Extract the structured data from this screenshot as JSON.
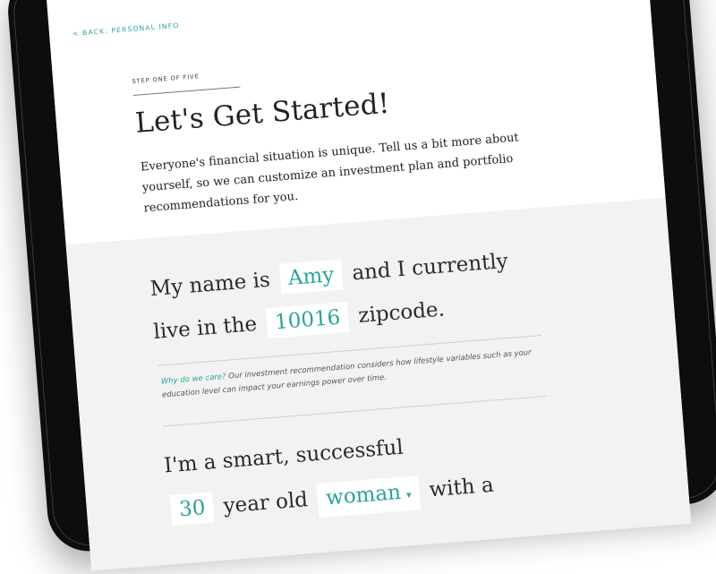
{
  "nav": {
    "back_label": "< BACK: PERSONAL INFO"
  },
  "step": {
    "label": "STEP ONE OF FIVE"
  },
  "page": {
    "title": "Let's Get Started!",
    "intro": "Everyone's financial situation is unique. Tell us a bit more about yourself, so we can customize an investment plan and portfolio recommendations for you."
  },
  "form": {
    "sentence1": {
      "pre": "My name is",
      "name_value": "Amy",
      "mid": "and I currently",
      "line2_pre": "live in the",
      "zip_value": "10016",
      "post": "zipcode."
    },
    "why": {
      "lead": "Why do we care?",
      "text": "Our investment recommendation considers how lifestyle variables such as your education level can impact your earnings power over time."
    },
    "sentence2": {
      "line1": "I'm a smart, successful",
      "age_value": "30",
      "mid": "year old",
      "gender_value": "woman",
      "post": "with a"
    }
  },
  "colors": {
    "accent": "#2aa39a",
    "device": "#0d0d0d",
    "form_bg": "#f2f2f2"
  }
}
